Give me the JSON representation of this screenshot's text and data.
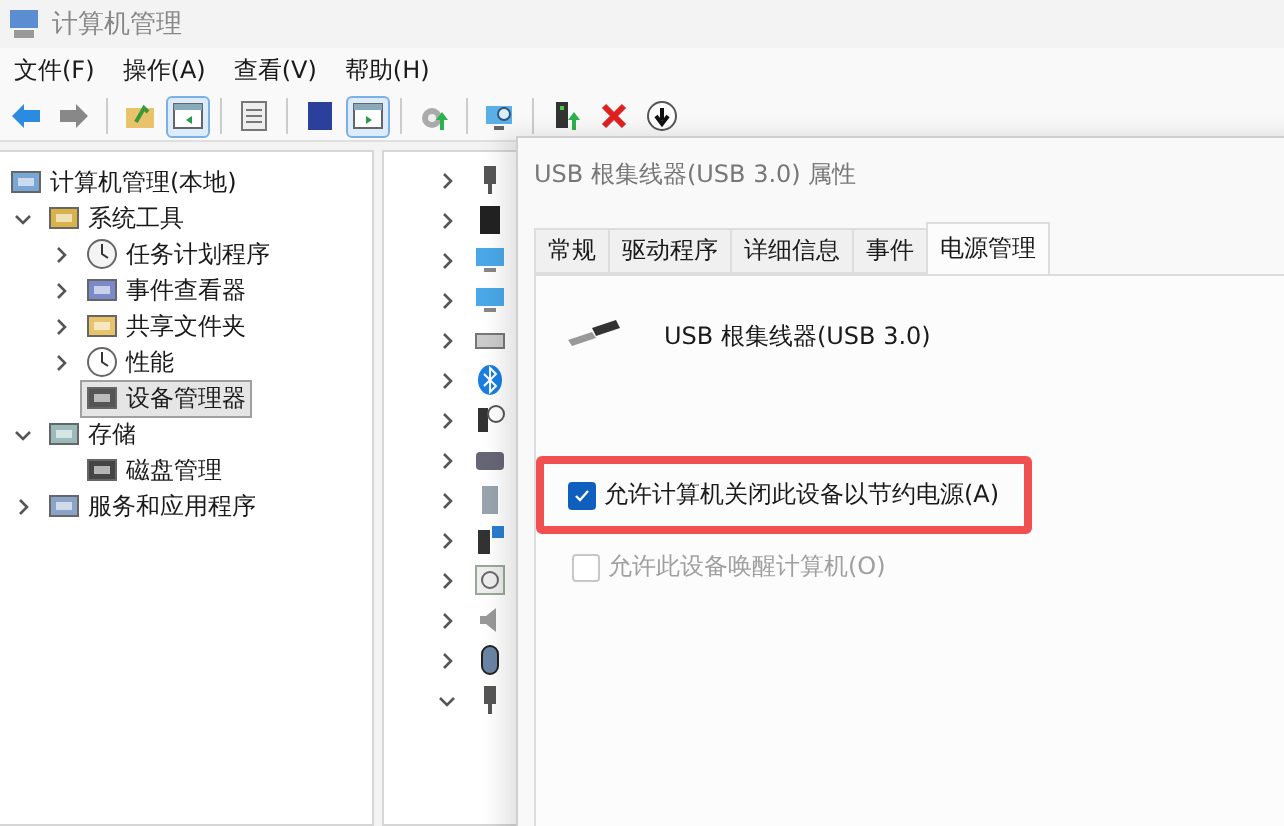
{
  "window": {
    "title": "计算机管理"
  },
  "menu": [
    "文件(F)",
    "操作(A)",
    "查看(V)",
    "帮助(H)"
  ],
  "toolbar": [
    {
      "selected": false
    },
    {
      "selected": false
    },
    {
      "selected": false
    },
    {
      "selected": true
    },
    {
      "selected": false
    },
    {
      "selected": false
    },
    {
      "selected": true
    },
    {
      "selected": false
    },
    {
      "selected": false
    },
    {
      "selected": false
    },
    {
      "selected": false
    },
    {
      "selected": false
    }
  ],
  "tree": [
    {
      "label": "计算机管理(本地)",
      "selected": false,
      "children": [
        {
          "label": "系统工具",
          "expanded": true,
          "selected": false,
          "children": [
            {
              "label": "任务计划程序",
              "expanded": false,
              "selected": false
            },
            {
              "label": "事件查看器",
              "expanded": false,
              "selected": false
            },
            {
              "label": "共享文件夹",
              "expanded": false,
              "selected": false
            },
            {
              "label": "性能",
              "expanded": false,
              "selected": false
            },
            {
              "label": "设备管理器",
              "selected": true
            }
          ]
        },
        {
          "label": "存储",
          "expanded": true,
          "selected": false,
          "children": [
            {
              "label": "磁盘管理",
              "selected": false
            }
          ]
        },
        {
          "label": "服务和应用程序",
          "expanded": false,
          "selected": false
        }
      ]
    }
  ],
  "devices": [
    {
      "expanded": false
    },
    {
      "expanded": false
    },
    {
      "expanded": false
    },
    {
      "expanded": false
    },
    {
      "expanded": false
    },
    {
      "expanded": false
    },
    {
      "expanded": false
    },
    {
      "expanded": false
    },
    {
      "expanded": false
    },
    {
      "expanded": false
    },
    {
      "expanded": false
    },
    {
      "expanded": false
    },
    {
      "expanded": false
    },
    {
      "expanded": true
    }
  ],
  "dialog": {
    "title": "USB 根集线器(USB 3.0) 属性",
    "tabs": [
      {
        "label": "常规",
        "selected": false
      },
      {
        "label": "驱动程序",
        "selected": false
      },
      {
        "label": "详细信息",
        "selected": false
      },
      {
        "label": "事件",
        "selected": false
      },
      {
        "label": "电源管理",
        "selected": true
      }
    ],
    "device_name": "USB 根集线器(USB 3.0)",
    "options": [
      {
        "label": "允许计算机关闭此设备以节约电源(A)",
        "checked": true,
        "disabled": false,
        "highlighted": true
      },
      {
        "label": "允许此设备唤醒计算机(O)",
        "checked": false,
        "disabled": true,
        "highlighted": false
      }
    ]
  }
}
